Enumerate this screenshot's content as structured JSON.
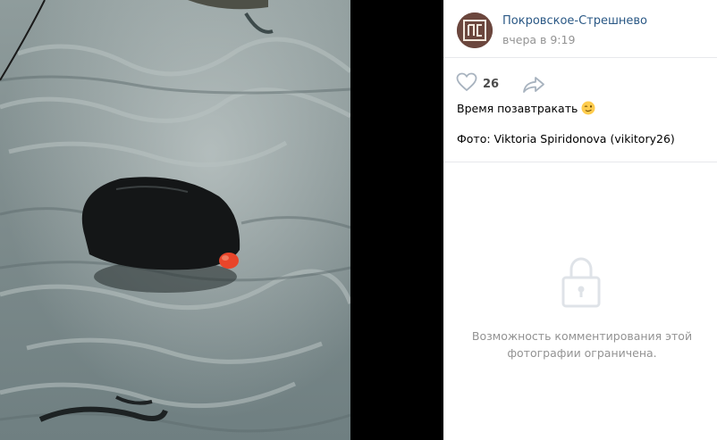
{
  "post": {
    "group_name": "Покровское-Стрешнево",
    "time": "вчера в 9:19",
    "likes": "26",
    "caption": "Время позавтракать",
    "credit": "Фото: Viktoria Spiridonova (vikitory26)"
  },
  "comments": {
    "locked_line1": "Возможность комментирования этой",
    "locked_line2": "фотографии ограничена."
  },
  "icons": {
    "like": "heart-icon",
    "share": "share-arrow-icon",
    "lock": "lock-icon",
    "emoji": "winking-face-emoji"
  },
  "colors": {
    "link": "#2a5885",
    "muted": "#939393",
    "divider": "#e7e8ec"
  }
}
